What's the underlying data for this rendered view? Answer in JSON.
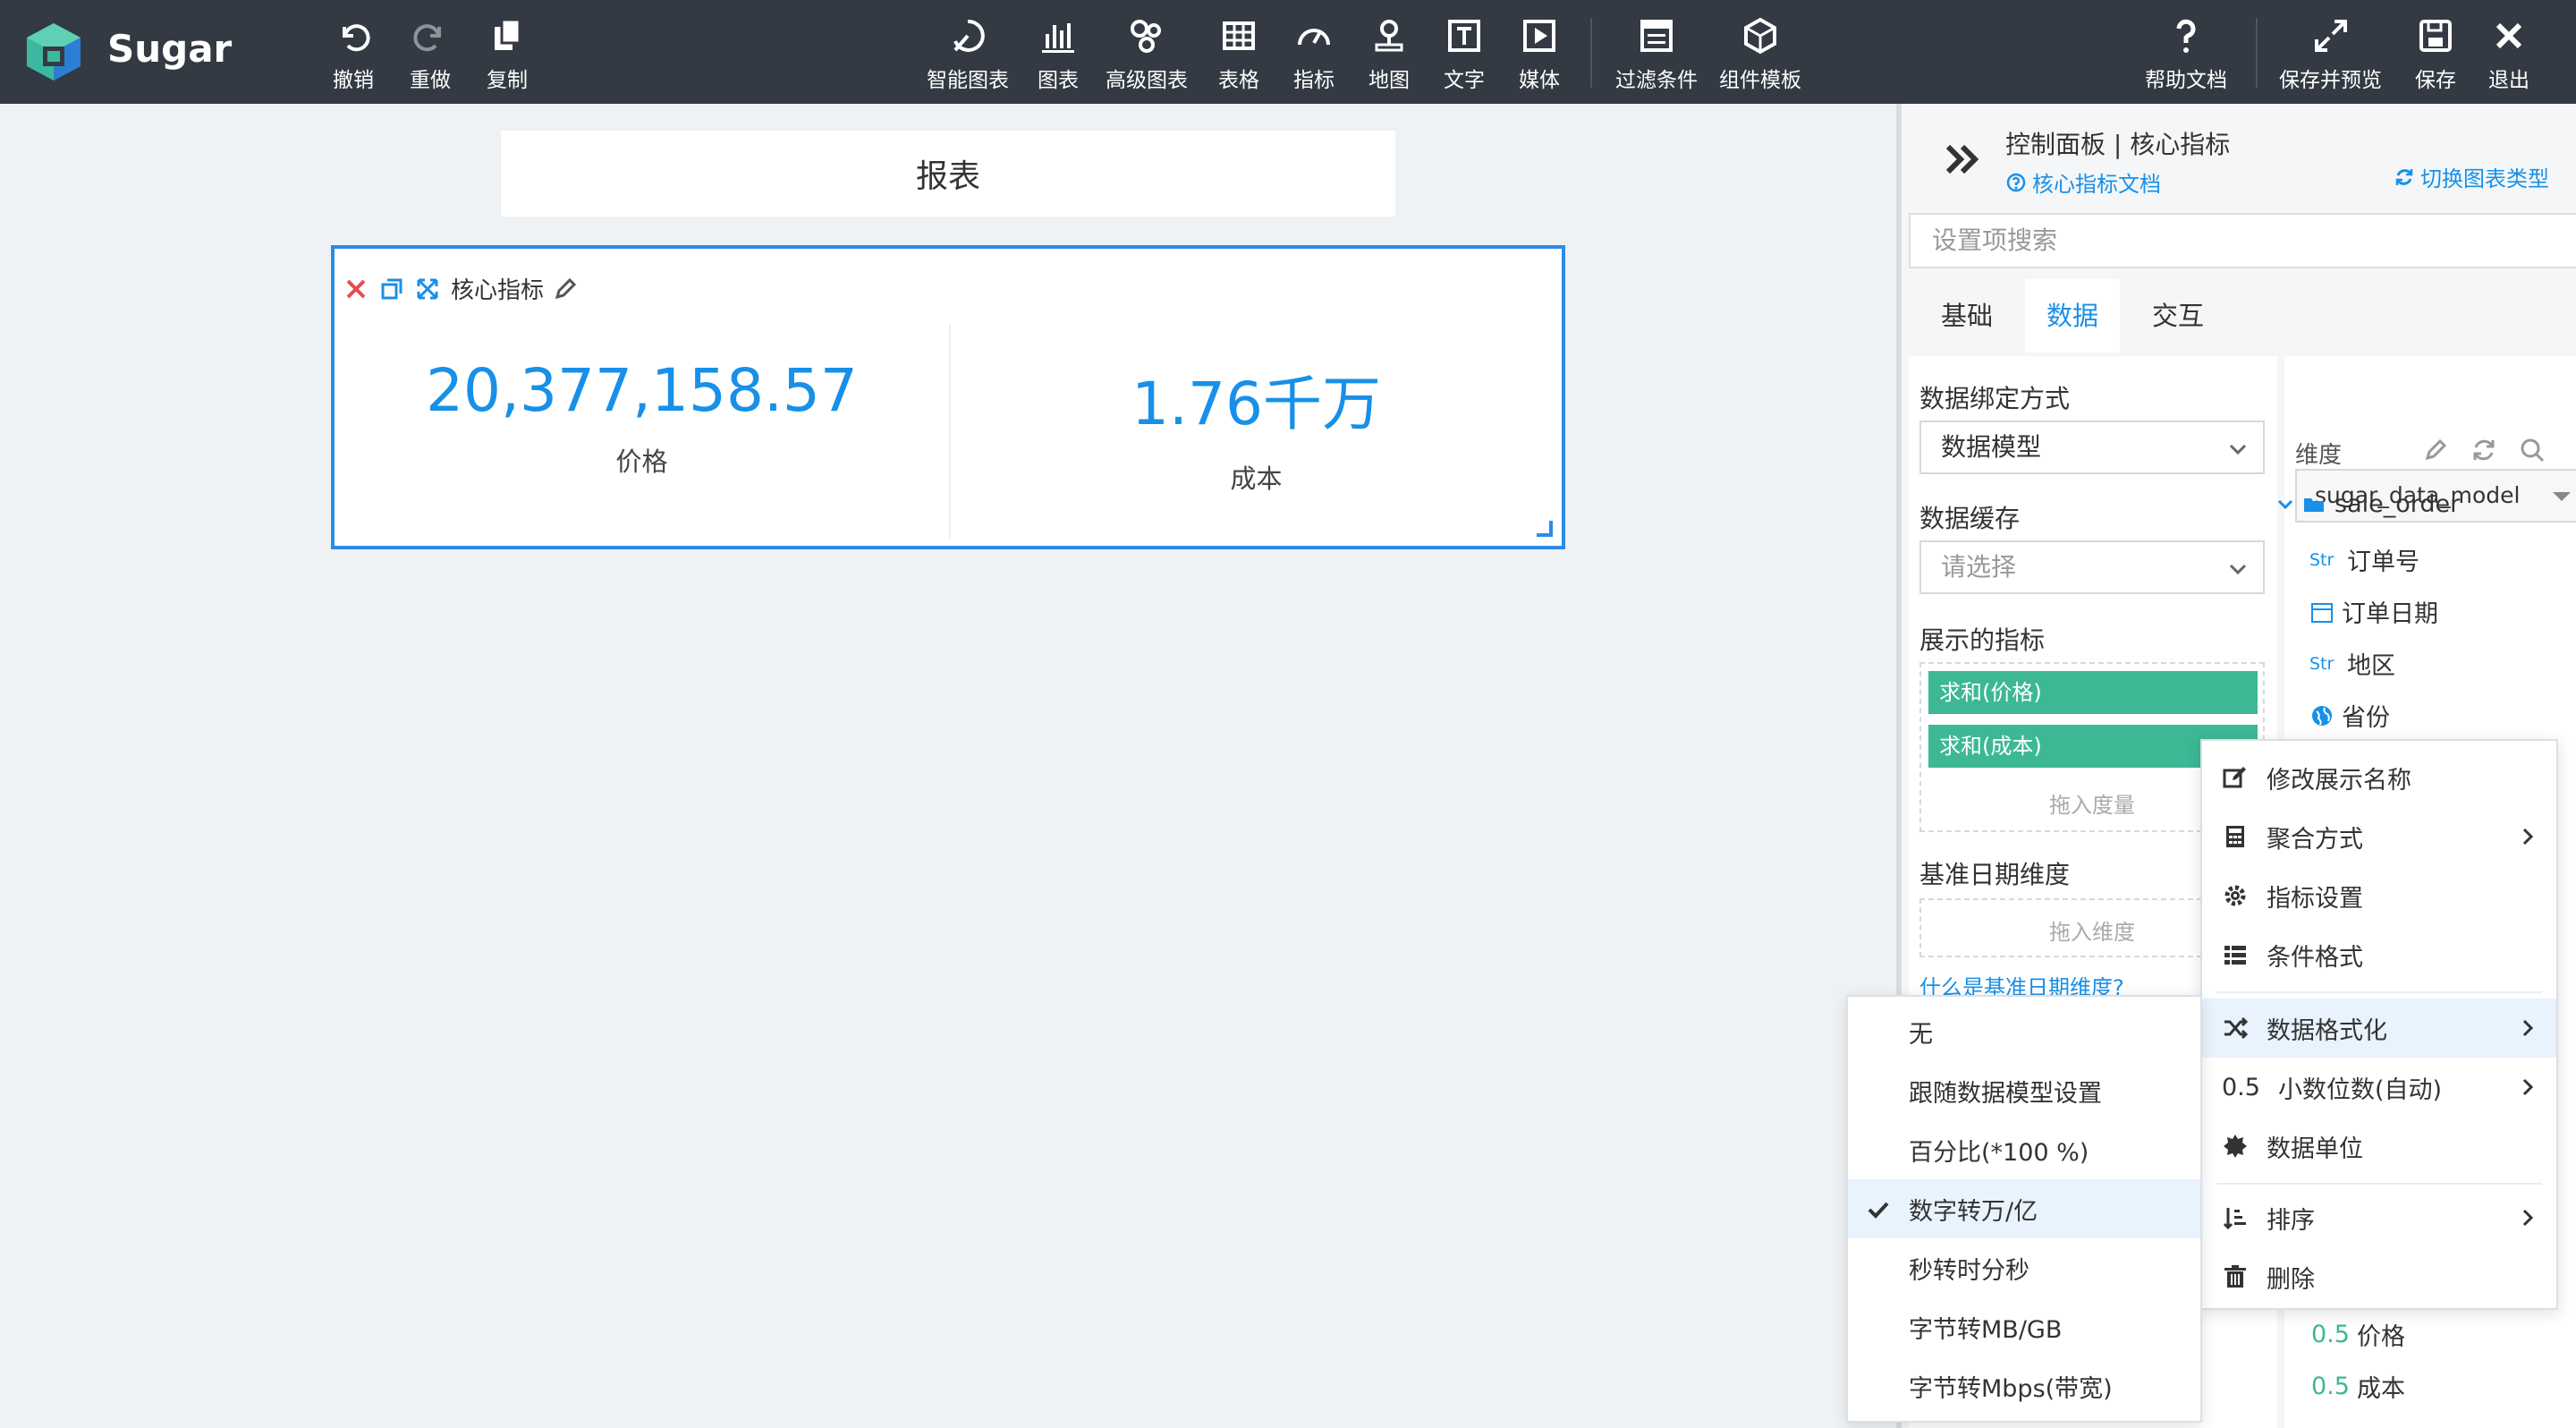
{
  "app": {
    "brand": "Sugar"
  },
  "toolbar": {
    "undo": "撤销",
    "redo": "重做",
    "copy": "复制",
    "smart_chart": "智能图表",
    "chart": "图表",
    "advanced_chart": "高级图表",
    "table": "表格",
    "metric": "指标",
    "map": "地图",
    "text": "文字",
    "media": "媒体",
    "filter": "过滤条件",
    "component_template": "组件模板",
    "help": "帮助文档",
    "save_preview": "保存并预览",
    "save": "保存",
    "exit": "退出"
  },
  "canvas": {
    "report_title": "报表",
    "card": {
      "title": "核心指标",
      "kpis": [
        {
          "value": "20,377,158.57",
          "label": "价格"
        },
        {
          "value": "1.76千万",
          "label": "成本"
        }
      ]
    }
  },
  "panel": {
    "breadcrumb": "控制面板 | 核心指标",
    "doc_link": "核心指标文档",
    "switch_type": "切换图表类型",
    "search_placeholder": "设置项搜索",
    "tabs": [
      "基础",
      "数据",
      "交互"
    ],
    "active_tab": "数据",
    "binding_label": "数据绑定方式",
    "binding_value": "数据模型",
    "cache_label": "数据缓存",
    "cache_placeholder": "请选择",
    "metrics_label": "展示的指标",
    "metrics": [
      "求和(价格)",
      "求和(成本)"
    ],
    "metrics_drop_hint": "拖入度量",
    "date_dim_label": "基准日期维度",
    "date_dim_drop_hint": "拖入维度",
    "date_dim_help": "什么是基准日期维度?",
    "model_select": "sugar_data_model",
    "dimension_title": "维度",
    "tree_folder": "sale_order",
    "fields": [
      {
        "tag": "Str",
        "name": "订单号"
      },
      {
        "tag": "",
        "name": "订单日期",
        "icon": "calendar-icon"
      },
      {
        "tag": "Str",
        "name": "地区"
      },
      {
        "tag": "",
        "name": "省份",
        "icon": "globe-icon"
      }
    ],
    "measures": [
      {
        "tag": "0.5",
        "name": "价格"
      },
      {
        "tag": "0.5",
        "name": "成本"
      }
    ]
  },
  "context_menu": {
    "items": [
      {
        "label": "修改展示名称",
        "icon": "edit-icon"
      },
      {
        "label": "聚合方式",
        "icon": "calculator-icon",
        "submenu": true
      },
      {
        "label": "指标设置",
        "icon": "gear-icon"
      },
      {
        "label": "条件格式",
        "icon": "list-icon"
      },
      {
        "label": "数据格式化",
        "icon": "shuffle-icon",
        "submenu": true,
        "highlighted": true
      },
      {
        "label": "小数位数(自动)",
        "icon_text": "0.5",
        "submenu": true
      },
      {
        "label": "数据单位",
        "icon": "badge-icon"
      },
      {
        "label": "排序",
        "icon": "sort-icon",
        "submenu": true
      },
      {
        "label": "删除",
        "icon": "trash-icon"
      }
    ]
  },
  "format_submenu": {
    "items": [
      "无",
      "跟随数据模型设置",
      "百分比(*100 %)",
      "数字转万/亿",
      "秒转时分秒",
      "字节转MB/GB",
      "字节转Mbps(带宽)"
    ],
    "selected": "数字转万/亿"
  },
  "colors": {
    "toolbar_bg": "#333a43",
    "accent": "#1890e8",
    "pill": "#3cb895",
    "canvas_bg": "#eff2f4"
  }
}
